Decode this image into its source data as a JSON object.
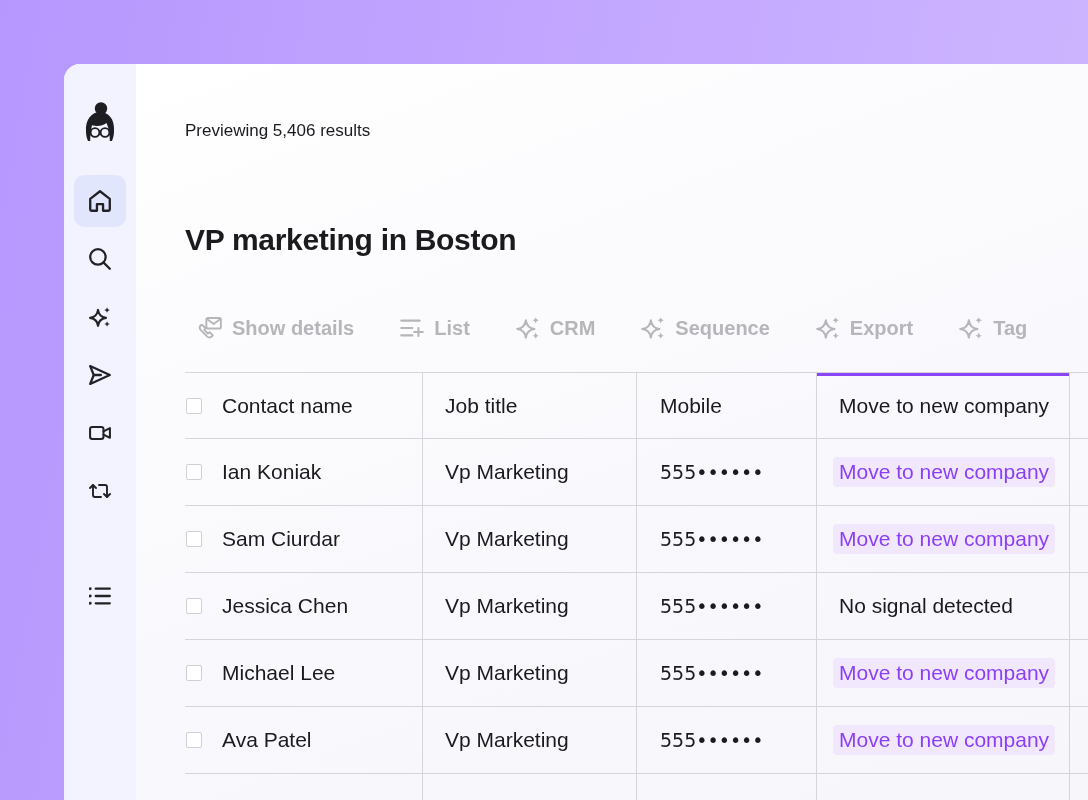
{
  "sidebar": {
    "items": [
      {
        "selected": true
      },
      {
        "selected": false
      },
      {
        "selected": false
      },
      {
        "selected": false
      },
      {
        "selected": false
      },
      {
        "selected": false
      }
    ],
    "lower_items": [
      {
        "selected": false
      }
    ]
  },
  "results_summary": "Previewing 5,406 results",
  "title": "VP marketing in Boston",
  "toolbar": [
    {
      "label": "Show details",
      "disabled": true
    },
    {
      "label": "List",
      "disabled": true
    },
    {
      "label": "CRM",
      "disabled": true
    },
    {
      "label": "Sequence",
      "disabled": true
    },
    {
      "label": "Export",
      "disabled": true
    },
    {
      "label": "Tag",
      "disabled": true
    }
  ],
  "table": {
    "select_all": {
      "checked": false
    },
    "columns": [
      {
        "label": "Contact name",
        "selected": false
      },
      {
        "label": "Job title",
        "selected": false
      },
      {
        "label": "Mobile",
        "selected": false
      },
      {
        "label": "Move to new company",
        "selected": true
      }
    ],
    "rows": [
      {
        "checked": false,
        "contact_name": "Ian Koniak",
        "job_title": "Vp Marketing",
        "mobile": "555••••••",
        "signal": {
          "kind": "badge",
          "text": "Move to new company"
        }
      },
      {
        "checked": false,
        "contact_name": "Sam Ciurdar",
        "job_title": "Vp Marketing",
        "mobile": "555••••••",
        "signal": {
          "kind": "badge",
          "text": "Move to new company"
        }
      },
      {
        "checked": false,
        "contact_name": "Jessica Chen",
        "job_title": "Vp Marketing",
        "mobile": "555••••••",
        "signal": {
          "kind": "text",
          "text": "No signal detected"
        }
      },
      {
        "checked": false,
        "contact_name": "Michael Lee",
        "job_title": "Vp Marketing",
        "mobile": "555••••••",
        "signal": {
          "kind": "badge",
          "text": "Move to new company"
        }
      },
      {
        "checked": false,
        "contact_name": "Ava Patel",
        "job_title": "Vp Marketing",
        "mobile": "555••••••",
        "signal": {
          "kind": "badge",
          "text": "Move to new company"
        }
      }
    ]
  }
}
